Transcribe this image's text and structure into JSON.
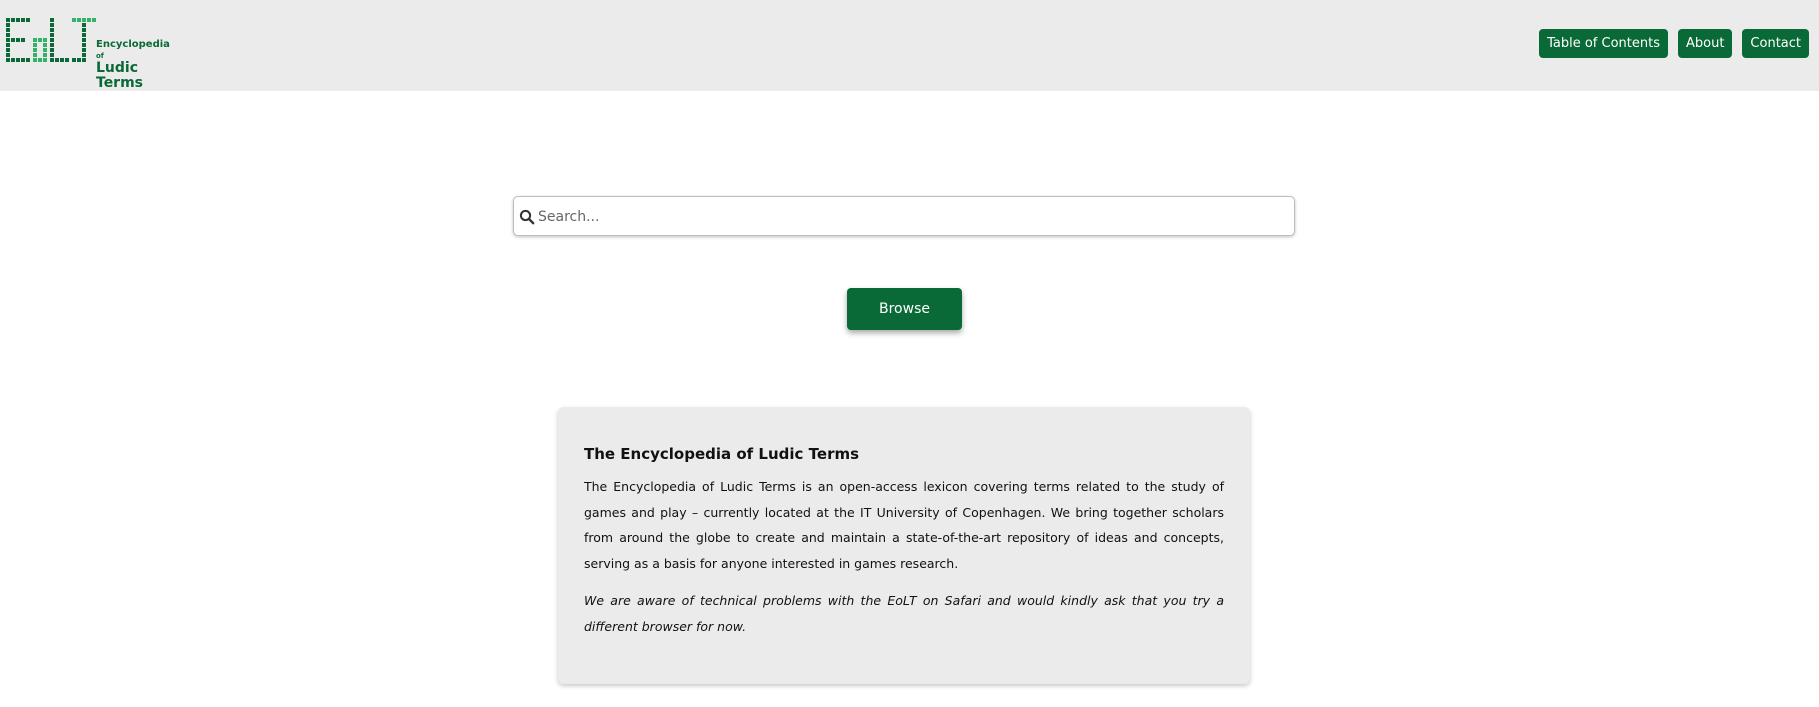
{
  "brand": {
    "logo_mark": "EoLT",
    "logo_line1": "Encyclopedia",
    "logo_of": "of",
    "logo_line2": "Ludic Terms",
    "color": "#0a6a37"
  },
  "nav": {
    "items": [
      "Table of Contents",
      "About",
      "Contact"
    ]
  },
  "search": {
    "placeholder": "Search...",
    "value": "",
    "icon": "search-icon"
  },
  "browse": {
    "label": "Browse"
  },
  "intro": {
    "title": "The Encyclopedia of Ludic Terms",
    "body": "The Encyclopedia of Ludic Terms is an open-access lexicon covering terms related to the study of games and play – currently located at the IT University of Copenhagen. We bring together scholars from around the globe to create and maintain a state-of-the-art repository of ideas and concepts, serving as a basis for anyone interested in games research.",
    "notice": "We are aware of technical problems with the EoLT on Safari and would kindly ask that you try a different browser for now."
  },
  "colors": {
    "accent": "#0a6a37",
    "header_bg": "#ebebeb",
    "card_bg": "#ebebeb"
  }
}
